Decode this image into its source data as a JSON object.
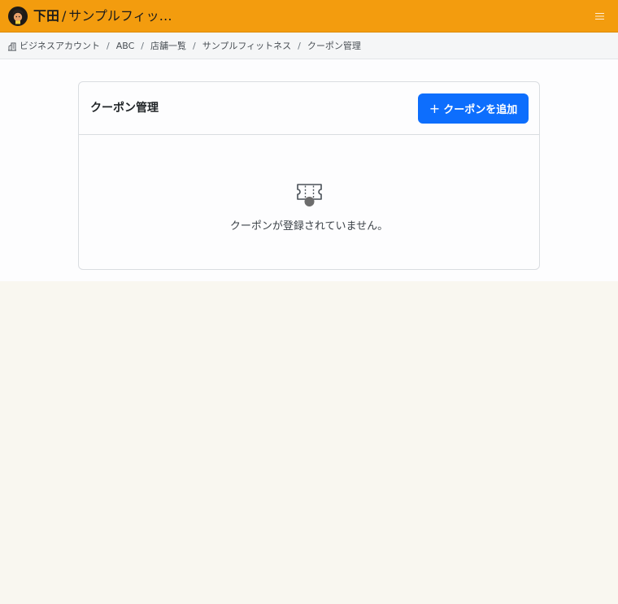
{
  "header": {
    "user_name": "下田",
    "separator": "/",
    "store_name": "サンプルフィッ…",
    "avatar_icon": "avatar-icon",
    "menu_icon": "hamburger-menu-icon",
    "background_color": "#f39c0e"
  },
  "breadcrumb": {
    "icon": "building-icon",
    "separator": "/",
    "items": [
      {
        "label": "ビジネスアカウント"
      },
      {
        "label": "ABC"
      },
      {
        "label": "店舗一覧"
      },
      {
        "label": "サンプルフィットネス"
      },
      {
        "label": "クーポン管理"
      }
    ]
  },
  "card": {
    "title": "クーポン管理",
    "add_button": {
      "icon": "plus-icon",
      "label": "クーポンを追加",
      "color": "#0d6efd"
    },
    "empty_state": {
      "icon": "ticket-icon",
      "message": "クーポンが登録されていません。"
    }
  }
}
